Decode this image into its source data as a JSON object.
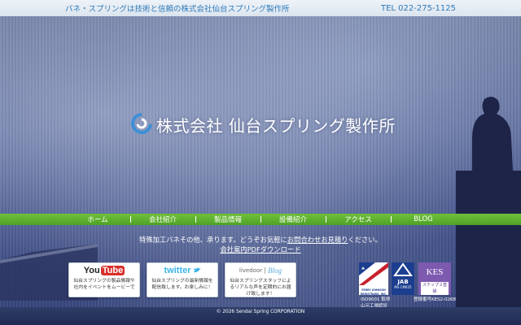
{
  "header": {
    "tagline": "バネ・スプリングは技術と信頼の株式会社仙台スプリング製作所",
    "tel": "TEL 022-275-1125"
  },
  "logo": {
    "name": "株式会社 仙台スプリング製作所",
    "icon": "spring-logo-icon"
  },
  "nav": {
    "items": [
      "ホーム",
      "会社紹介",
      "製品情報",
      "設備紹介",
      "アクセス",
      "BLOG"
    ]
  },
  "notice": {
    "prefix": "特殊加工バネその他、承ります。どうぞお気軽に",
    "link": "お問合わせお見積り",
    "suffix": "ください。",
    "pdf_link": "会社案内PDFダウンロード"
  },
  "banners": {
    "youtube": {
      "you": "You",
      "tube": "Tube",
      "desc": "仙台スプリングの製品情報や社内をイベントをムービーで"
    },
    "twitter": {
      "logo": "twitter",
      "desc": "仙台スプリングの最新情報を配信致します。お楽しみに！"
    },
    "blog": {
      "brand": "livedoor",
      "logo": "Blog",
      "desc": "仙台スプリングスタッフによるリアルな声を定期的にお届け致します！"
    }
  },
  "certs": {
    "pj_text": "PERRY JOHNSON REGISTRARS, INC.",
    "jab_text": "JAB",
    "jab_sub": "MS CM025",
    "kes_title": "KES",
    "kes_sub": "ステップ２登録",
    "caption_iso": "ISO9001 取得",
    "caption_iso_link": "山元工場認証",
    "caption_kes": "登録番号KES2-0268"
  },
  "footer": {
    "copyright": "© 2026 Sendai Spring CORPORATION"
  },
  "colors": {
    "accent_blue": "#2f7ab8",
    "nav_green": "#5cae2c",
    "footer_navy": "#24305a"
  }
}
